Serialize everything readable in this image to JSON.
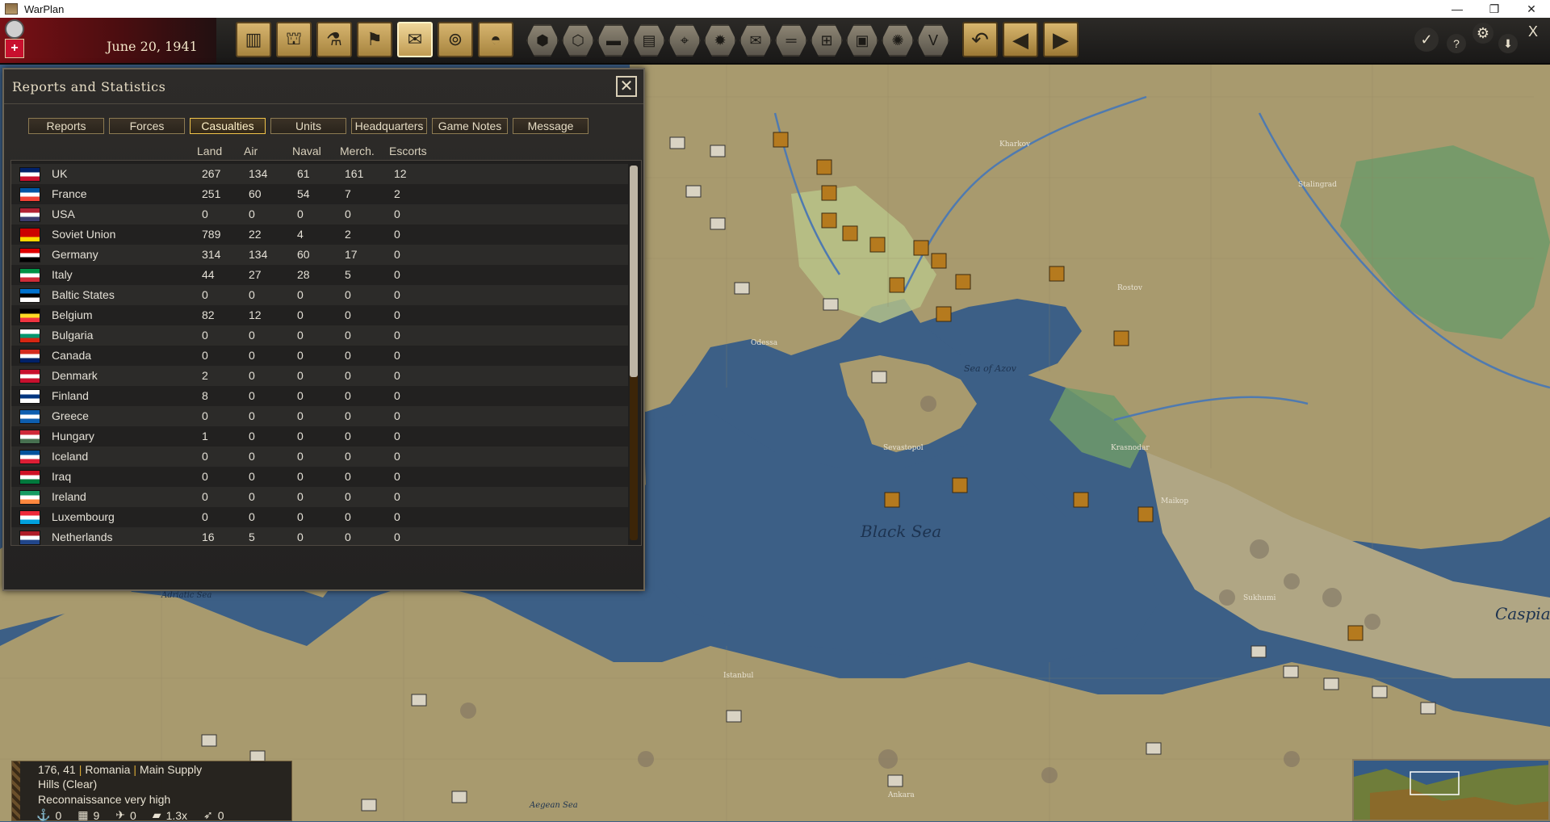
{
  "window": {
    "title": "WarPlan",
    "controls": [
      "—",
      "❐",
      "✕"
    ]
  },
  "toolbar": {
    "date": "June 20, 1941",
    "main_buttons": [
      {
        "name": "production-button",
        "glyph": "▥"
      },
      {
        "name": "economy-button",
        "glyph": "⛫"
      },
      {
        "name": "research-button",
        "glyph": "⚗"
      },
      {
        "name": "diplomacy-button",
        "glyph": "⚑"
      },
      {
        "name": "reports-button",
        "glyph": "✉"
      },
      {
        "name": "recon-button",
        "glyph": "⊚"
      },
      {
        "name": "units-button",
        "glyph": "◓"
      }
    ],
    "filter_buttons": [
      "⬢",
      "⬡",
      "▬",
      "▤",
      "⌖",
      "✹",
      "✉",
      "═",
      "⊞",
      "▣",
      "✺",
      "V"
    ],
    "nav_buttons": [
      "↶",
      "◀",
      "▶"
    ],
    "right_buttons": [
      "✓",
      "?",
      "⚙",
      "⬇",
      "X"
    ]
  },
  "panel": {
    "title": "Reports and Statistics",
    "close": "✕",
    "tabs": [
      {
        "label": "Reports",
        "active": false
      },
      {
        "label": "Forces",
        "active": false
      },
      {
        "label": "Casualties",
        "active": true
      },
      {
        "label": "Units",
        "active": false
      },
      {
        "label": "Headquarters",
        "active": false
      },
      {
        "label": "Game Notes",
        "active": false
      },
      {
        "label": "Message",
        "active": false
      }
    ],
    "columns": [
      "Land",
      "Air",
      "Naval",
      "Merch.",
      "Escorts"
    ],
    "rows": [
      {
        "country": "UK",
        "land": "267",
        "air": "134",
        "naval": "61",
        "merch": "161",
        "escorts": "12"
      },
      {
        "country": "France",
        "land": "251",
        "air": "60",
        "naval": "54",
        "merch": "7",
        "escorts": "2"
      },
      {
        "country": "USA",
        "land": "0",
        "air": "0",
        "naval": "0",
        "merch": "0",
        "escorts": "0"
      },
      {
        "country": "Soviet Union",
        "land": "789",
        "air": "22",
        "naval": "4",
        "merch": "2",
        "escorts": "0"
      },
      {
        "country": "Germany",
        "land": "314",
        "air": "134",
        "naval": "60",
        "merch": "17",
        "escorts": "0"
      },
      {
        "country": "Italy",
        "land": "44",
        "air": "27",
        "naval": "28",
        "merch": "5",
        "escorts": "0"
      },
      {
        "country": "Baltic States",
        "land": "0",
        "air": "0",
        "naval": "0",
        "merch": "0",
        "escorts": "0"
      },
      {
        "country": "Belgium",
        "land": "82",
        "air": "12",
        "naval": "0",
        "merch": "0",
        "escorts": "0"
      },
      {
        "country": "Bulgaria",
        "land": "0",
        "air": "0",
        "naval": "0",
        "merch": "0",
        "escorts": "0"
      },
      {
        "country": "Canada",
        "land": "0",
        "air": "0",
        "naval": "0",
        "merch": "0",
        "escorts": "0"
      },
      {
        "country": "Denmark",
        "land": "2",
        "air": "0",
        "naval": "0",
        "merch": "0",
        "escorts": "0"
      },
      {
        "country": "Finland",
        "land": "8",
        "air": "0",
        "naval": "0",
        "merch": "0",
        "escorts": "0"
      },
      {
        "country": "Greece",
        "land": "0",
        "air": "0",
        "naval": "0",
        "merch": "0",
        "escorts": "0"
      },
      {
        "country": "Hungary",
        "land": "1",
        "air": "0",
        "naval": "0",
        "merch": "0",
        "escorts": "0"
      },
      {
        "country": "Iceland",
        "land": "0",
        "air": "0",
        "naval": "0",
        "merch": "0",
        "escorts": "0"
      },
      {
        "country": "Iraq",
        "land": "0",
        "air": "0",
        "naval": "0",
        "merch": "0",
        "escorts": "0"
      },
      {
        "country": "Ireland",
        "land": "0",
        "air": "0",
        "naval": "0",
        "merch": "0",
        "escorts": "0"
      },
      {
        "country": "Luxembourg",
        "land": "0",
        "air": "0",
        "naval": "0",
        "merch": "0",
        "escorts": "0"
      },
      {
        "country": "Netherlands",
        "land": "16",
        "air": "5",
        "naval": "0",
        "merch": "0",
        "escorts": "0"
      }
    ],
    "flag_colors": {
      "UK": [
        "#012169",
        "#ffffff",
        "#c8102e"
      ],
      "France": [
        "#0055a4",
        "#ffffff",
        "#ef4135"
      ],
      "USA": [
        "#b22234",
        "#ffffff",
        "#3c3b6e"
      ],
      "Soviet Union": [
        "#cc0000",
        "#cc0000",
        "#ffd700"
      ],
      "Germany": [
        "#dd0000",
        "#ffffff",
        "#000000"
      ],
      "Italy": [
        "#009246",
        "#ffffff",
        "#ce2b37"
      ],
      "Baltic States": [
        "#0072ce",
        "#000000",
        "#ffffff"
      ],
      "Belgium": [
        "#000000",
        "#fdda24",
        "#ef3340"
      ],
      "Bulgaria": [
        "#ffffff",
        "#00966e",
        "#d62612"
      ],
      "Canada": [
        "#d52b1e",
        "#ffffff",
        "#012169"
      ],
      "Denmark": [
        "#c8102e",
        "#ffffff",
        "#c8102e"
      ],
      "Finland": [
        "#ffffff",
        "#003580",
        "#ffffff"
      ],
      "Greece": [
        "#0d5eaf",
        "#ffffff",
        "#0d5eaf"
      ],
      "Hungary": [
        "#ce2939",
        "#ffffff",
        "#477050"
      ],
      "Iceland": [
        "#02529c",
        "#ffffff",
        "#dc1e35"
      ],
      "Iraq": [
        "#ce1126",
        "#ffffff",
        "#007a3d"
      ],
      "Ireland": [
        "#169b62",
        "#ffffff",
        "#ff883e"
      ],
      "Luxembourg": [
        "#ed2939",
        "#ffffff",
        "#00a1de"
      ],
      "Netherlands": [
        "#ae1c28",
        "#ffffff",
        "#21468b"
      ]
    }
  },
  "map": {
    "labels": {
      "black_sea": "Black Sea",
      "caspian": "Caspian",
      "sea_of_azov": "Sea of Azov",
      "aegean_sea": "Aegean Sea",
      "adriatic_sea": "Adriatic Sea",
      "sevastopol": "Sevastopol",
      "krasnodar": "Krasnodar",
      "stalingrad": "Stalingrad",
      "kharkov": "Kharkov",
      "rostov": "Rostov",
      "odessa": "Odessa",
      "istanbul": "Istanbul",
      "ankara": "Ankara",
      "maikop": "Maikop",
      "sukhumi": "Sukhumi"
    }
  },
  "info": {
    "coords": "176, 41",
    "country": "Romania",
    "supply": "Main Supply",
    "terrain": "Hills (Clear)",
    "recon": "Reconnaissance very high",
    "stats": [
      {
        "icon": "⚓",
        "value": "0"
      },
      {
        "icon": "▦",
        "value": "9"
      },
      {
        "icon": "✈",
        "value": "0"
      },
      {
        "icon": "▰",
        "value": "1.3x"
      },
      {
        "icon": "➶",
        "value": "0"
      }
    ]
  },
  "colors": {
    "sea": "#3c5f86",
    "land": "#a89a6e",
    "accent": "#f0c34a"
  }
}
